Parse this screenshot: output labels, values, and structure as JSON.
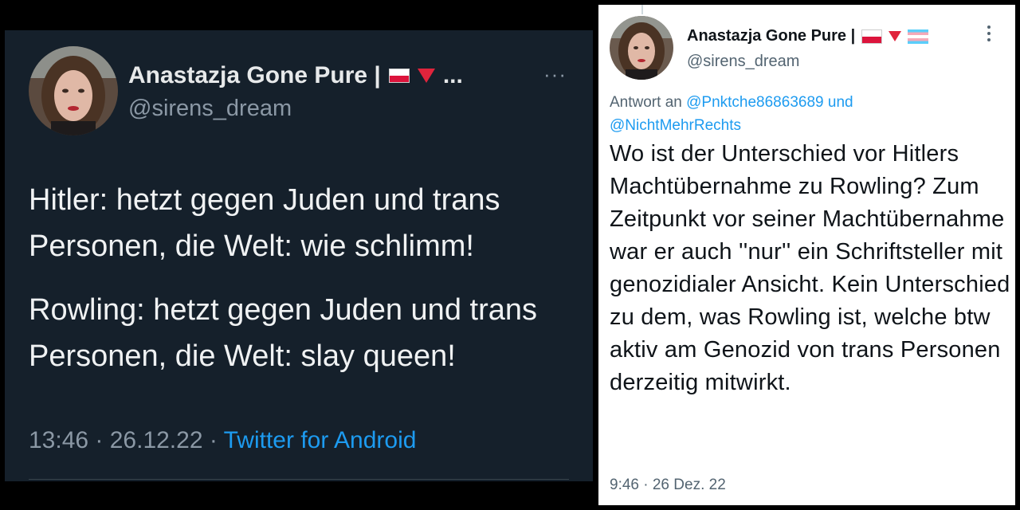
{
  "left_tweet": {
    "name": "Anastazja Gone Pure |",
    "name_emoji": [
      "flag-poland-icon",
      "red-triangle-down-icon"
    ],
    "name_ellipsis": "...",
    "handle": "@sirens_dream",
    "more": "···",
    "paragraphs": [
      "Hitler: hetzt gegen Juden und trans Personen, die Welt:  wie schlimm!",
      "Rowling: hetzt gegen Juden und trans Personen, die Welt: slay queen!"
    ],
    "time": "13:46 · 26.12.22 · ",
    "source": "Twitter for Android"
  },
  "right_tweet": {
    "name": "Anastazja Gone Pure |",
    "name_emoji": [
      "flag-poland-icon",
      "red-triangle-down-icon",
      "transgender-flag-icon"
    ],
    "handle": "@sirens_dream",
    "reply_prefix": "Antwort an ",
    "reply_mention_1": "@Pnktche86863689",
    "reply_and": " und",
    "reply_mention_2": "@NichtMehrRechts",
    "body": "Wo ist der Unterschied vor Hitlers Machtübernahme zu Rowling? Zum Zeitpunkt vor seiner Machtübernahme war er auch ''nur'' ein Schriftsteller mit genozidialer Ansicht. Kein Unterschied zu dem, was Rowling ist, welche btw aktiv am Genozid von trans Personen derzeitig mitwirkt.",
    "time": "9:46 · 26 Dez. 22"
  },
  "colors": {
    "dark_bg": "#15202b",
    "light_bg": "#ffffff",
    "link": "#1d9bf0",
    "muted_dark": "#8b98a5",
    "muted_light": "#536471"
  }
}
